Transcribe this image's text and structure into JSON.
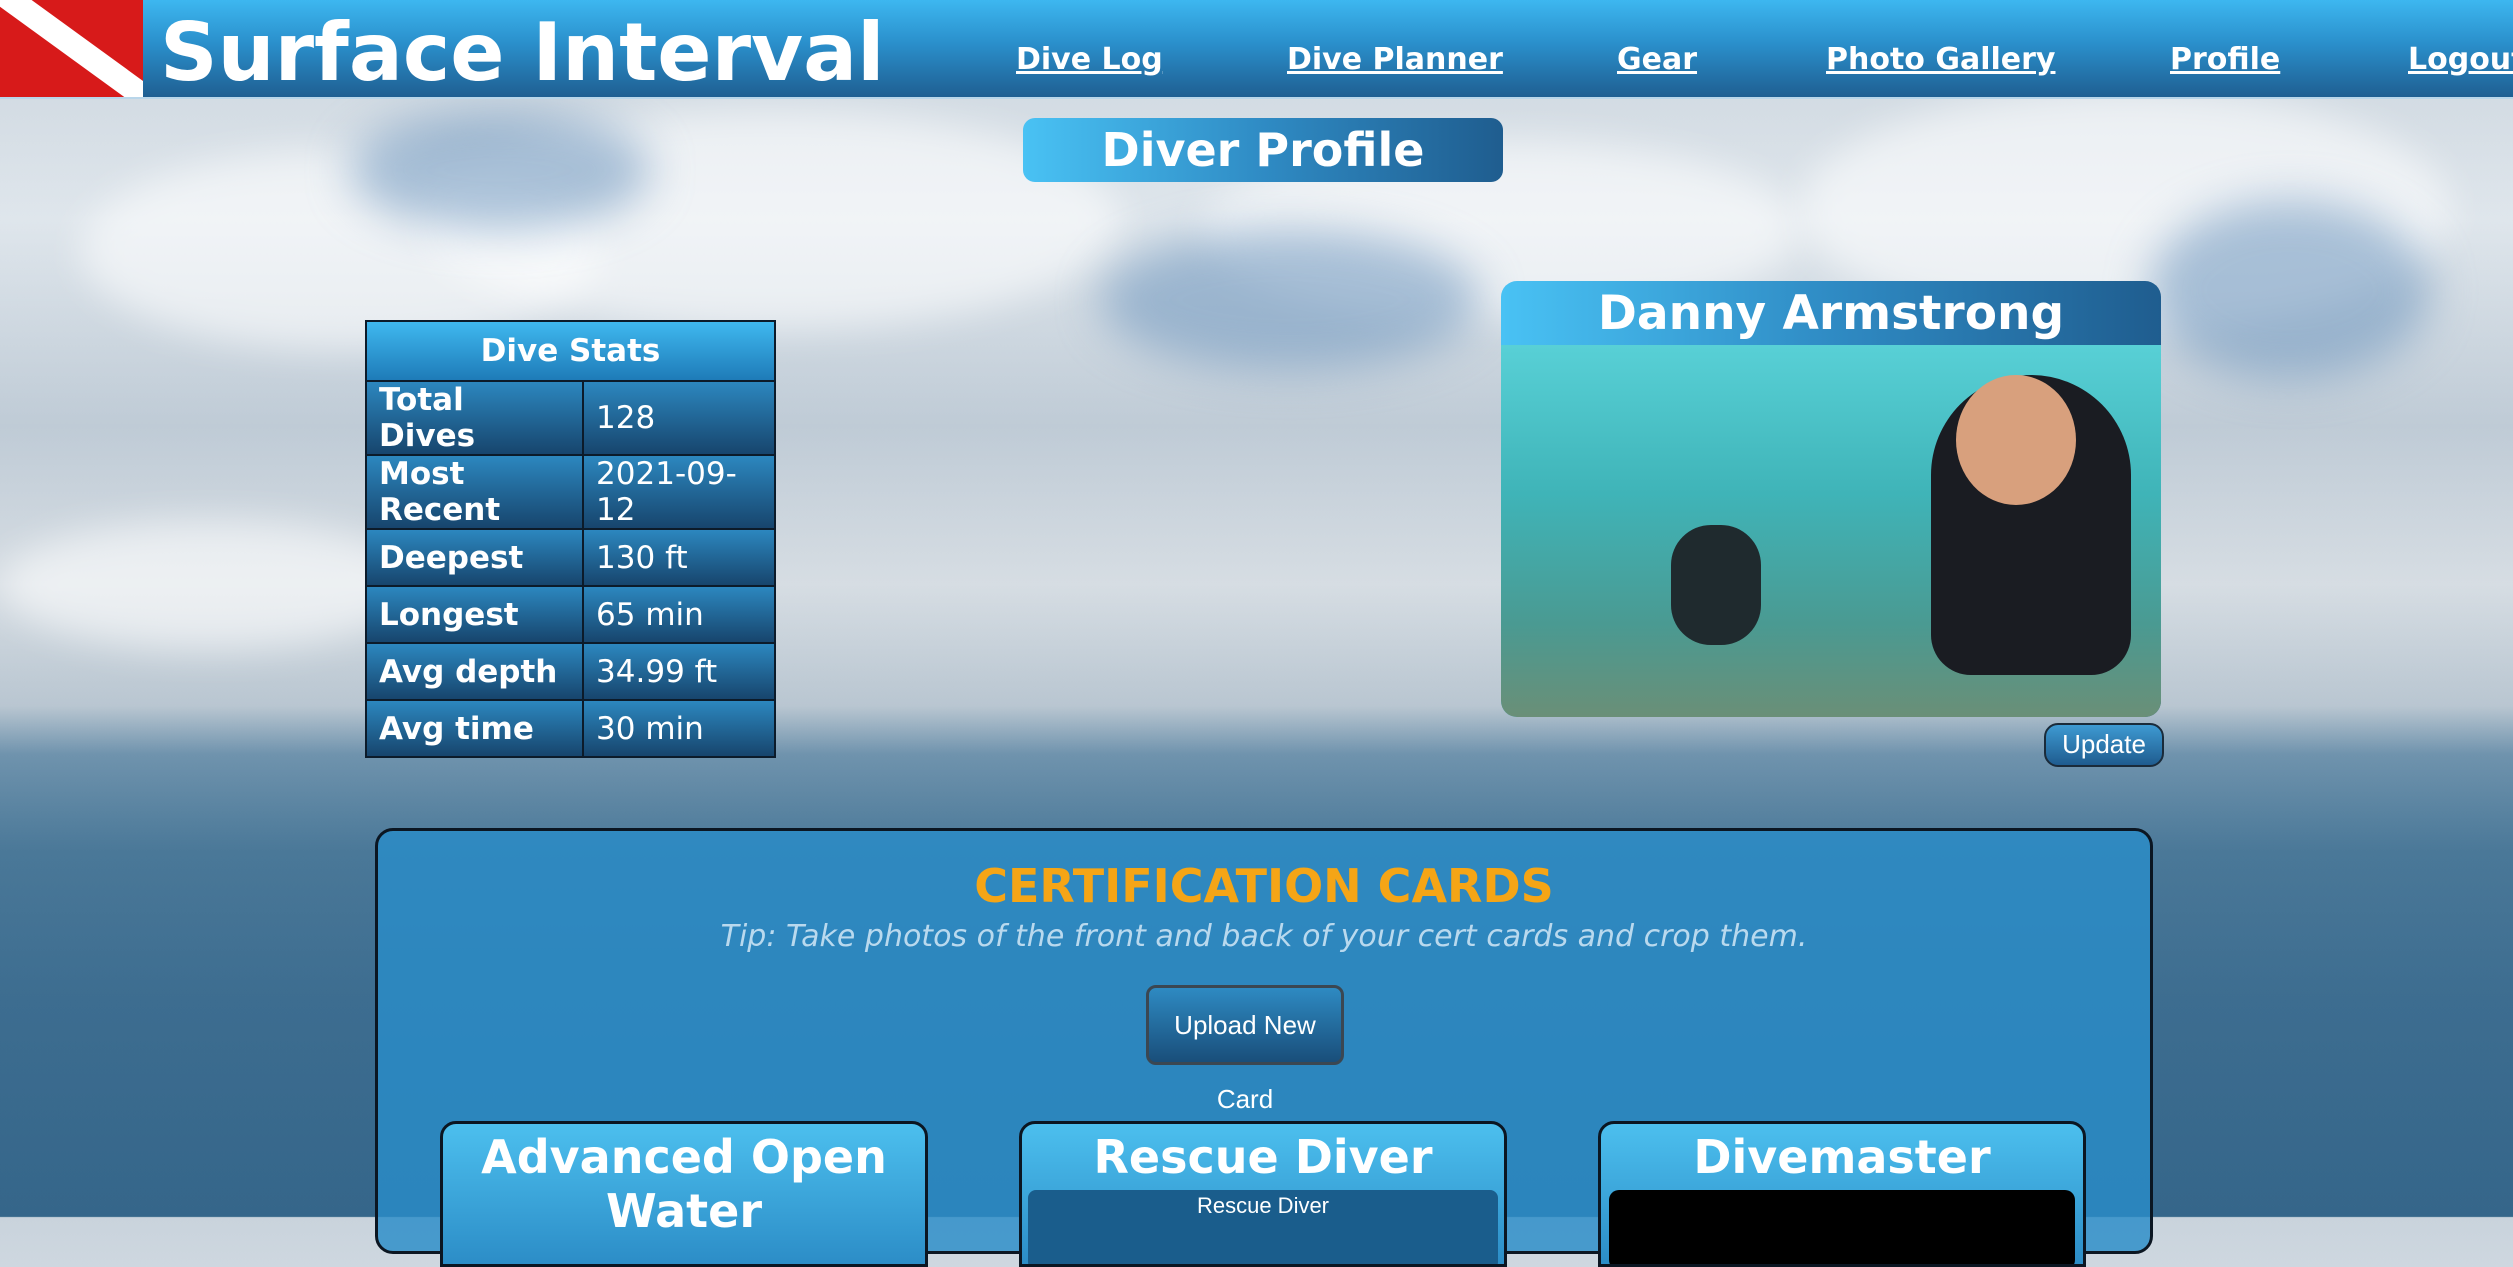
{
  "header": {
    "brand": "Surface Interval",
    "nav": [
      "Dive Log",
      "Dive Planner",
      "Gear",
      "Photo Gallery",
      "Profile",
      "Logout"
    ]
  },
  "page_title": "Diver Profile",
  "stats": {
    "title": "Dive Stats",
    "rows": [
      {
        "label": "Total Dives",
        "value": "128"
      },
      {
        "label": "Most Recent",
        "value": "2021-09-12"
      },
      {
        "label": "Deepest",
        "value": "130 ft"
      },
      {
        "label": "Longest",
        "value": "65 min"
      },
      {
        "label": "Avg depth",
        "value": "34.99 ft"
      },
      {
        "label": "Avg time",
        "value": "30 min"
      }
    ]
  },
  "profile": {
    "name": "Danny Armstrong",
    "update_label": "Update"
  },
  "certs": {
    "title": "CERTIFICATION CARDS",
    "tip": "Tip: Take photos of the front and back of your cert cards and crop them.",
    "upload_label": "Upload New Card",
    "cards": [
      {
        "title": "Advanced Open Water"
      },
      {
        "title": "Rescue Diver",
        "image_text": "Rescue Diver"
      },
      {
        "title": "Divemaster"
      }
    ]
  },
  "colors": {
    "accent": "#2f8bc4",
    "cert_title": "#f5a516",
    "flag_red": "#d71a1a"
  }
}
